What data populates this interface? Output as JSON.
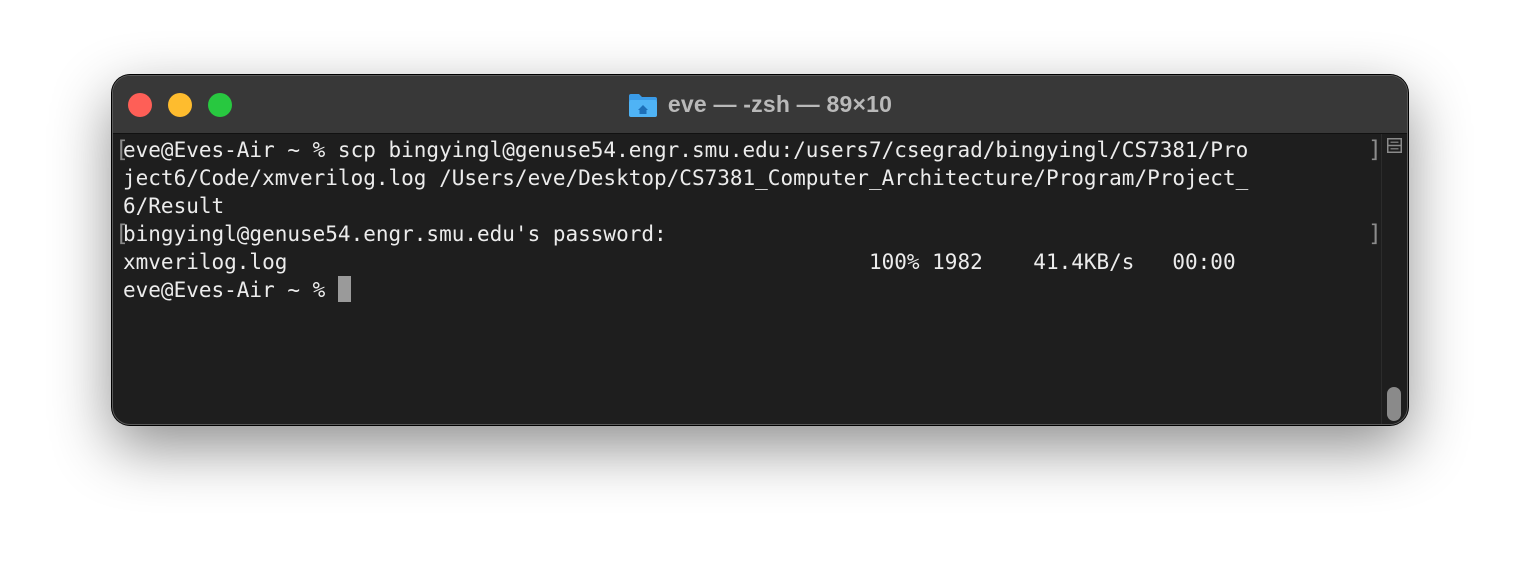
{
  "window": {
    "title": "eve — -zsh — 89×10",
    "icon": "folder-home-icon"
  },
  "terminal": {
    "lines": [
      "eve@Eves-Air ~ % scp bingyingl@genuse54.engr.smu.edu:/users7/csegrad/bingyingl/CS7381/Pro",
      "ject6/Code/xmverilog.log /Users/eve/Desktop/CS7381_Computer_Architecture/Program/Project_",
      "6/Result",
      "bingyingl@genuse54.engr.smu.edu's password:",
      "xmverilog.log                                              100% 1982    41.4KB/s   00:00",
      "eve@Eves-Air ~ % "
    ],
    "mark_open": "[",
    "mark_close": "]"
  },
  "colors": {
    "close": "#fe5f57",
    "minimize": "#febc2e",
    "zoom": "#28c840",
    "background": "#1e1e1e",
    "text": "#ececec"
  }
}
